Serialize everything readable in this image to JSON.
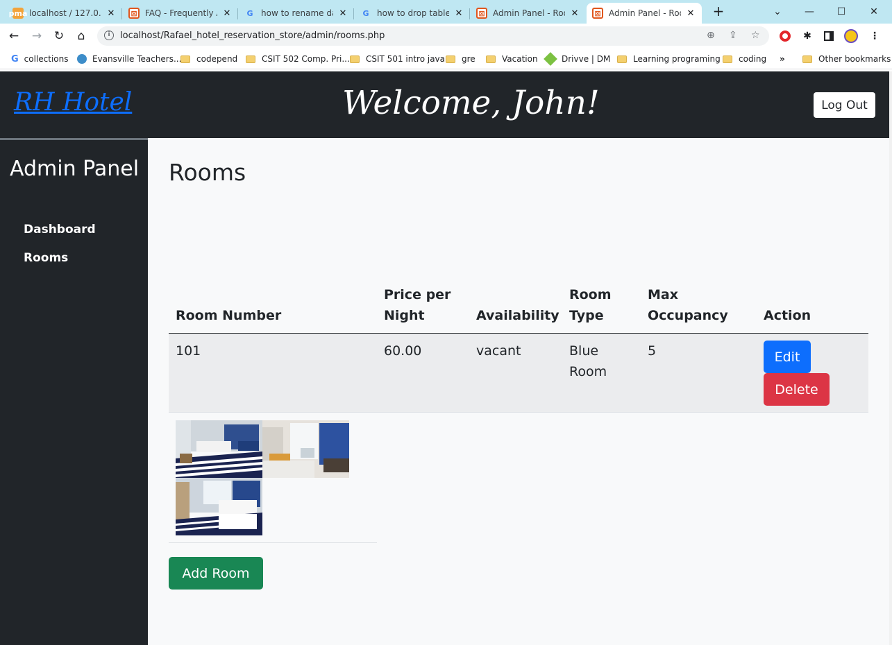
{
  "browser": {
    "tabs": [
      {
        "title": "localhost / 127.0.0.1",
        "icon": "phpmyadmin-icon"
      },
      {
        "title": "FAQ - Frequently Asked",
        "icon": "xampp-icon"
      },
      {
        "title": "how to rename database",
        "icon": "google-icon"
      },
      {
        "title": "how to drop table in",
        "icon": "google-icon"
      },
      {
        "title": "Admin Panel - Rooms",
        "icon": "xampp-icon"
      },
      {
        "title": "Admin Panel - Rooms",
        "icon": "xampp-icon"
      }
    ],
    "url": "localhost/Rafael_hotel_reservation_store/admin/rooms.php",
    "bookmarks": [
      {
        "label": "collections",
        "icon": "google-icon"
      },
      {
        "label": "Evansville Teachers...",
        "icon": "credit-union-icon"
      },
      {
        "label": "codepend",
        "icon": "folder-icon"
      },
      {
        "label": "CSIT 502 Comp. Pri...",
        "icon": "folder-icon"
      },
      {
        "label": "CSIT 501 intro java",
        "icon": "folder-icon"
      },
      {
        "label": "gre",
        "icon": "folder-icon"
      },
      {
        "label": "Vacation",
        "icon": "folder-icon"
      },
      {
        "label": "Drivve | DM",
        "icon": "drivve-icon"
      },
      {
        "label": "Learning programing",
        "icon": "folder-icon"
      },
      {
        "label": "coding",
        "icon": "folder-icon"
      }
    ],
    "more_bookmarks": "»",
    "other_bookmarks": "Other bookmarks"
  },
  "header": {
    "brand": "RH Hotel",
    "welcome": "Welcome, John!",
    "logout_label": "Log Out"
  },
  "sidebar": {
    "title": "Admin Panel",
    "items": [
      {
        "label": "Dashboard"
      },
      {
        "label": "Rooms"
      }
    ]
  },
  "main": {
    "title": "Rooms",
    "columns": [
      {
        "line1": "",
        "line2": "Room Number"
      },
      {
        "line1": "Price per",
        "line2": "Night"
      },
      {
        "line1": "",
        "line2": "Availability"
      },
      {
        "line1": "Room",
        "line2": "Type"
      },
      {
        "line1": "Max",
        "line2": "Occupancy"
      },
      {
        "line1": "",
        "line2": "Action"
      }
    ],
    "rows": [
      {
        "room_number": "101",
        "price": "60.00",
        "availability": "vacant",
        "room_type_line1": "Blue",
        "room_type_line2": "Room",
        "max_occupancy": "5",
        "edit_label": "Edit",
        "delete_label": "Delete"
      }
    ],
    "add_room_label": "Add Room"
  },
  "colors": {
    "navbar": "#212529",
    "brand_link": "#0d6efd",
    "edit_button": "#0d6efd",
    "delete_button": "#dc3545",
    "add_button": "#198754",
    "content_bg": "#f8f9fa"
  }
}
